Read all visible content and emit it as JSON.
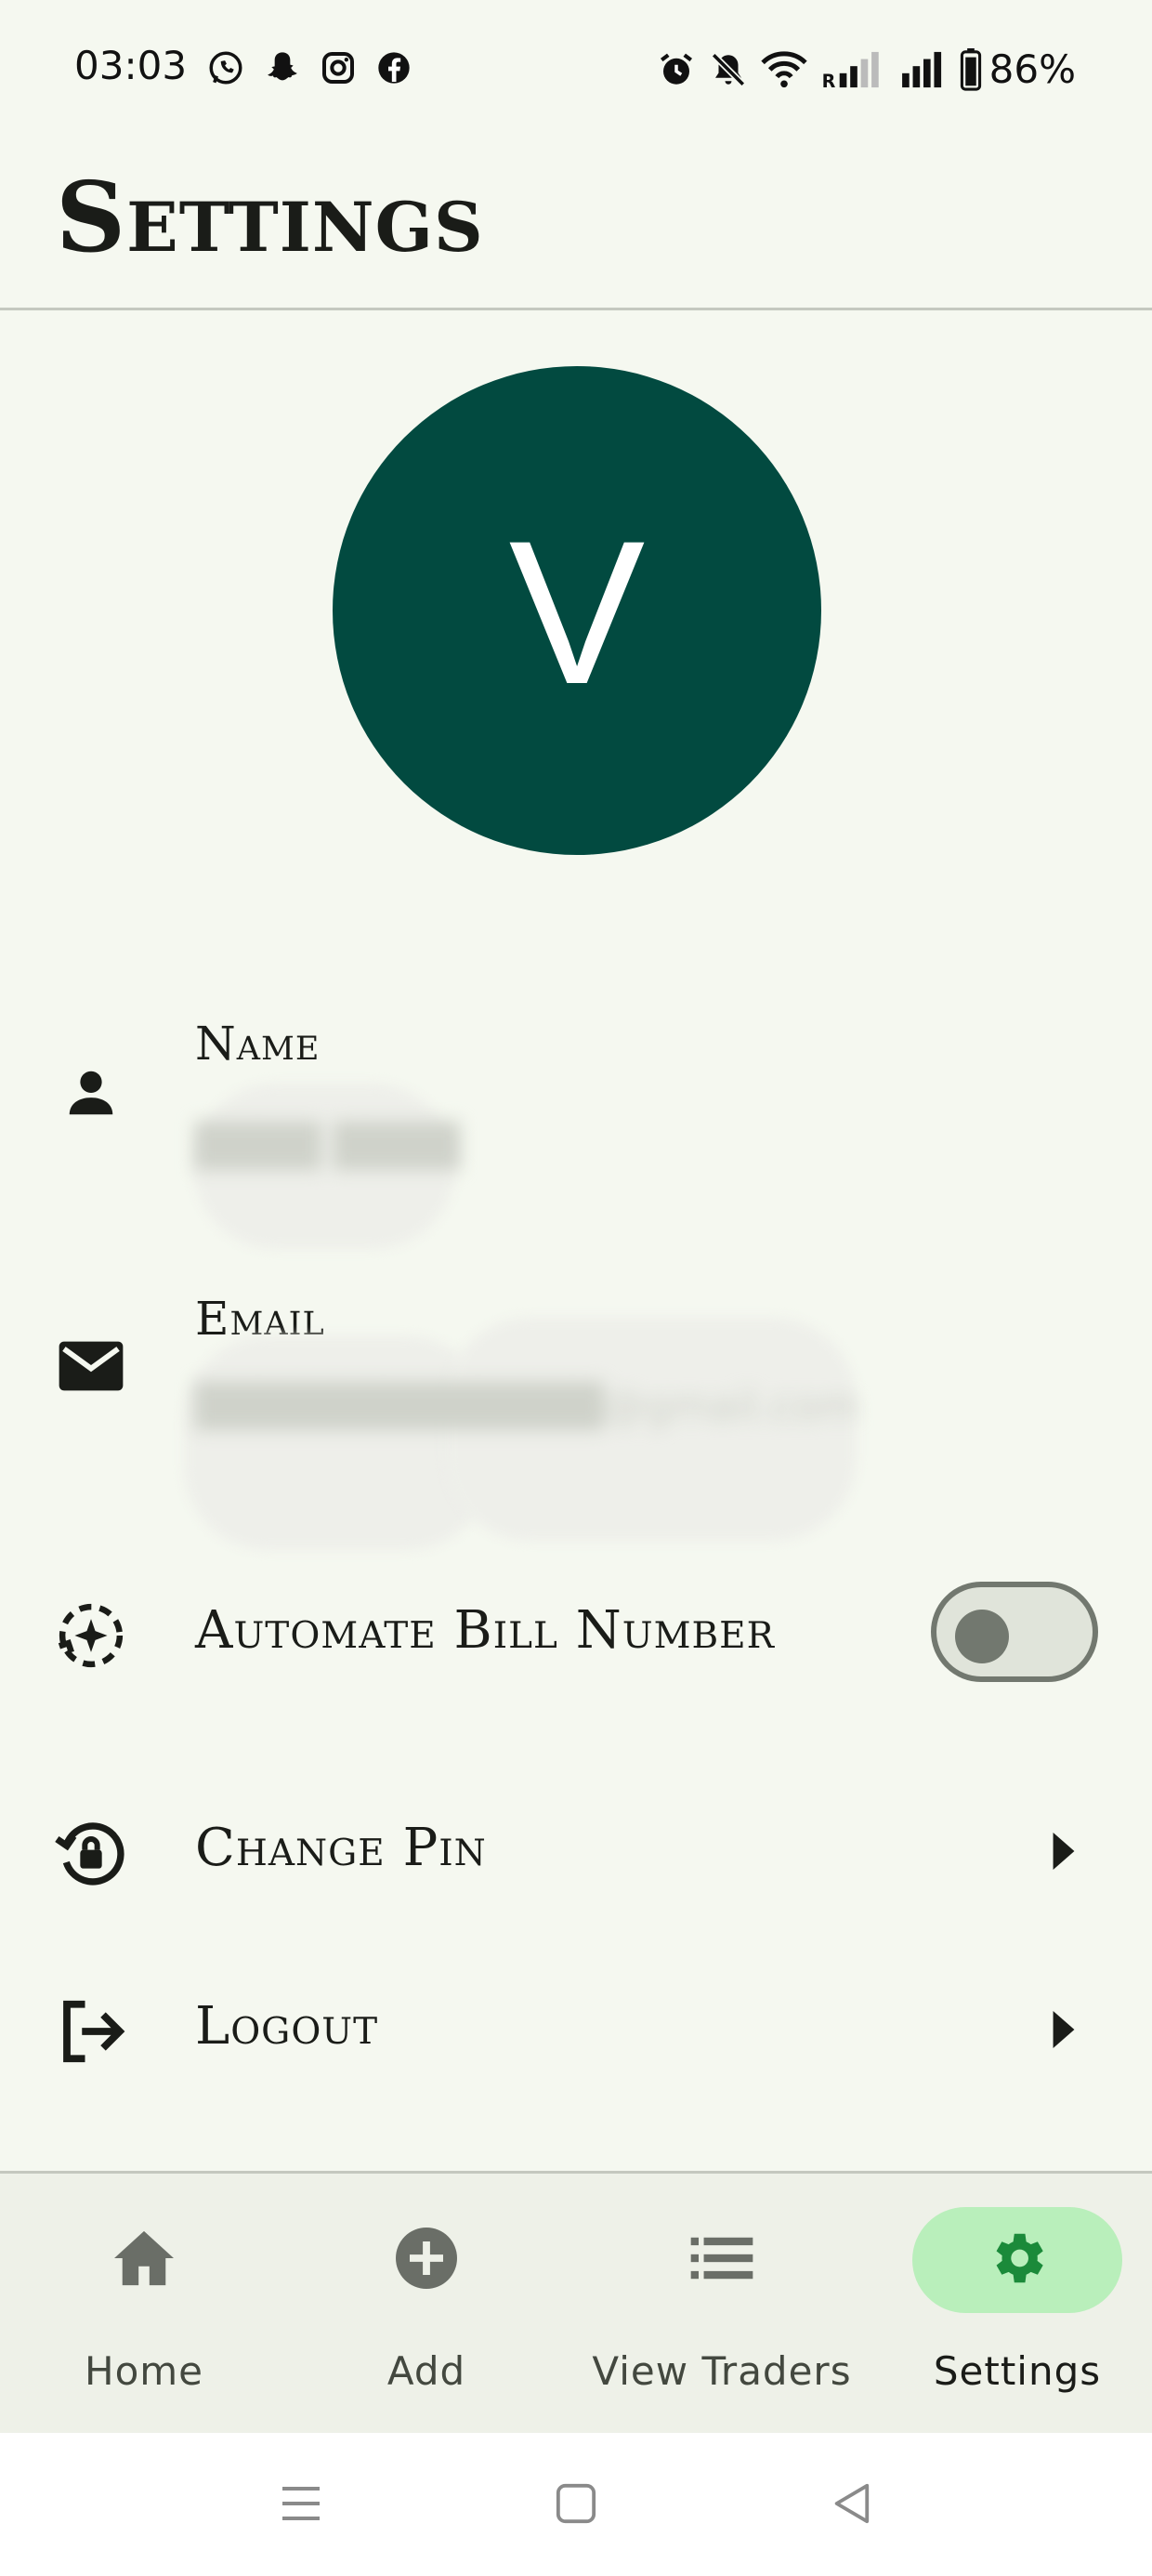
{
  "status_bar": {
    "time": "03:03",
    "notification_icons": [
      "whatsapp-icon",
      "snapchat-icon",
      "instagram-icon",
      "facebook-icon"
    ],
    "system_icons": [
      "alarm-icon",
      "mute-icon",
      "wifi-icon",
      "signal-roaming-icon",
      "signal-icon",
      "battery-icon"
    ],
    "battery": "86%"
  },
  "header": {
    "title": "Settings"
  },
  "profile": {
    "avatar_letter": "V",
    "avatar_color": "#024a40"
  },
  "fields": {
    "name": {
      "label": "Name",
      "value": "████ ████"
    },
    "email": {
      "label": "Email",
      "value": "█████████████@gmail.com"
    }
  },
  "options": {
    "automate_bill": {
      "label": "Automate Bill Number",
      "enabled": false
    },
    "change_pin": {
      "label": "Change Pin"
    },
    "logout": {
      "label": "Logout"
    }
  },
  "bottom_nav": {
    "items": [
      {
        "label": "Home",
        "icon": "home-icon",
        "active": false
      },
      {
        "label": "Add",
        "icon": "add-circle-icon",
        "active": false
      },
      {
        "label": "View Traders",
        "icon": "list-icon",
        "active": false
      },
      {
        "label": "Settings",
        "icon": "gear-icon",
        "active": true
      }
    ],
    "active_color": "#b9efbb",
    "active_icon_color": "#1b8a3a"
  },
  "system_nav": [
    "menu-icon",
    "home-square-icon",
    "back-icon"
  ]
}
